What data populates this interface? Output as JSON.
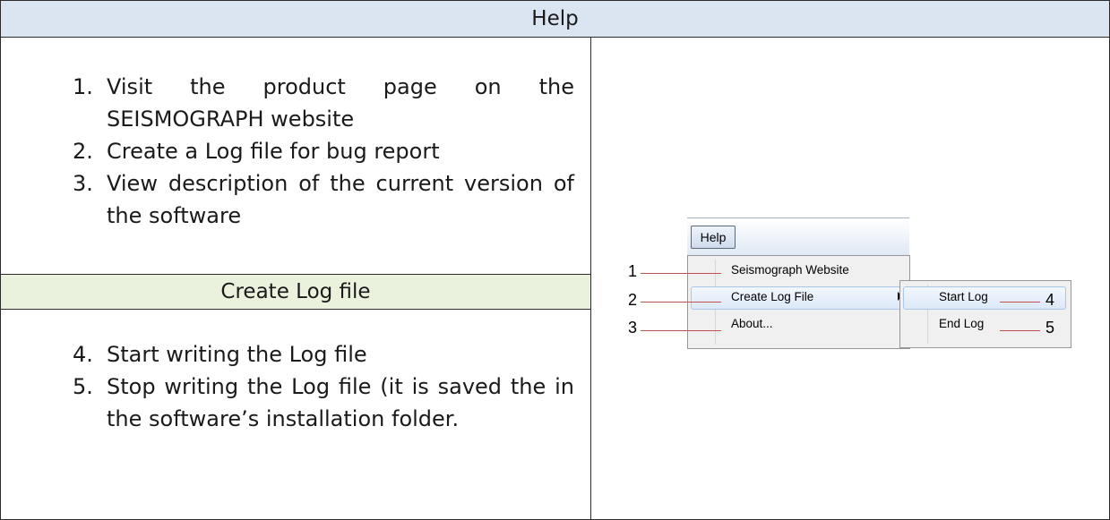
{
  "header": {
    "title": "Help"
  },
  "top_list": [
    {
      "num": "1.",
      "text": "Visit the product page on the SEISMOGRAPH website"
    },
    {
      "num": "2.",
      "text": "Create a Log file for bug report"
    },
    {
      "num": "3.",
      "text": "View description of the current version of the software"
    }
  ],
  "sub_header": {
    "title": "Create Log file"
  },
  "bottom_list": [
    {
      "num": "4.",
      "text": "Start writing the Log file"
    },
    {
      "num": "5.",
      "text": "Stop writing the Log file (it is saved the in the software’s installation folder."
    }
  ],
  "menu": {
    "menubar_label": "Help",
    "items": [
      "Seismograph Website",
      "Create Log File",
      "About..."
    ],
    "submenu_items": [
      "Start Log",
      "End Log"
    ],
    "callouts": [
      "1",
      "2",
      "3",
      "4",
      "5"
    ]
  },
  "colors": {
    "header_bg": "#dbe5f1",
    "sub_header_bg": "#eaf1dd",
    "leader": "#c0504d"
  }
}
